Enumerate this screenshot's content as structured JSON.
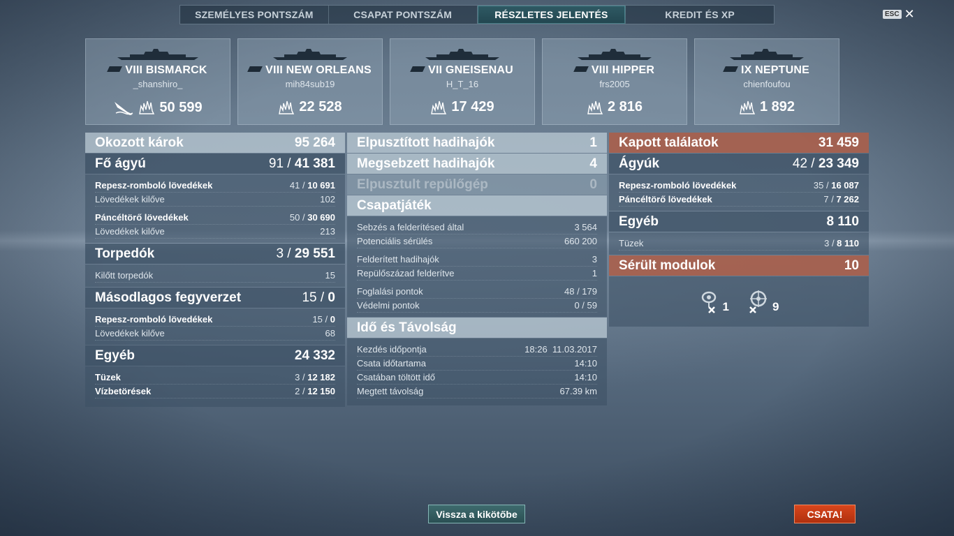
{
  "tabs": [
    "SZEMÉLYES PONTSZÁM",
    "CSAPAT PONTSZÁM",
    "RÉSZLETES JELENTÉS",
    "KREDIT ÉS XP"
  ],
  "active_tab": 2,
  "esc_label": "ESC",
  "cards": [
    {
      "ship": "VIII BISMARCK",
      "player": "_shanshiro_",
      "damage": "50 599",
      "icons": [
        "sunk-ship-icon",
        "damage-splash-icon"
      ]
    },
    {
      "ship": "VIII NEW ORLEANS",
      "player": "mih84sub19",
      "damage": "22 528",
      "icons": [
        "damage-splash-icon"
      ]
    },
    {
      "ship": "VII GNEISENAU",
      "player": "H_T_16",
      "damage": "17 429",
      "icons": [
        "damage-splash-icon"
      ]
    },
    {
      "ship": "VIII HIPPER",
      "player": "frs2005",
      "damage": "2 816",
      "icons": [
        "damage-splash-icon"
      ]
    },
    {
      "ship": "IX NEPTUNE",
      "player": "chienfoufou",
      "damage": "1 892",
      "icons": [
        "damage-splash-icon"
      ]
    }
  ],
  "col1": {
    "damage": {
      "label": "Okozott károk",
      "value": "95 264"
    },
    "main": {
      "label": "Fő ágyú",
      "hits": "91",
      "value": "41 381"
    },
    "he": {
      "label": "Repesz-romboló lövedékek",
      "hits": "41",
      "value": "10 691"
    },
    "he_fired": {
      "label": "Lövedékek kilőve",
      "value": "102"
    },
    "ap": {
      "label": "Páncéltörő lövedékek",
      "hits": "50",
      "value": "30 690"
    },
    "ap_fired": {
      "label": "Lövedékek kilőve",
      "value": "213"
    },
    "torp": {
      "label": "Torpedók",
      "hits": "3",
      "value": "29 551"
    },
    "torp_fired": {
      "label": "Kilőtt torpedók",
      "value": "15"
    },
    "sec": {
      "label": "Másodlagos fegyverzet",
      "hits": "15",
      "value": "0"
    },
    "sec_he": {
      "label": "Repesz-romboló lövedékek",
      "hits": "15",
      "value": "0"
    },
    "sec_fired": {
      "label": "Lövedékek kilőve",
      "value": "68"
    },
    "other": {
      "label": "Egyéb",
      "value": "24 332"
    },
    "fires": {
      "label": "Tüzek",
      "hits": "3",
      "value": "12 182"
    },
    "flood": {
      "label": "Vízbetörések",
      "hits": "2",
      "value": "12 150"
    }
  },
  "col2": {
    "destroyed": {
      "label": "Elpusztított hadihajók",
      "value": "1"
    },
    "damaged": {
      "label": "Megsebzett hadihajók",
      "value": "4"
    },
    "planes": {
      "label": "Elpusztult repülőgép",
      "value": "0"
    },
    "team": {
      "label": "Csapatjáték"
    },
    "spot_dmg": {
      "label": "Sebzés a felderítésed által",
      "value": "3 564"
    },
    "potential": {
      "label": "Potenciális sérülés",
      "value": "660 200"
    },
    "spotted": {
      "label": "Felderített hadihajók",
      "value": "3"
    },
    "squad": {
      "label": "Repülőszázad felderítve",
      "value": "1"
    },
    "capture": {
      "label": "Foglalási pontok",
      "value": "48 / 179"
    },
    "defense": {
      "label": "Védelmi pontok",
      "value": "0 / 59"
    },
    "time": {
      "label": "Idő és Távolság"
    },
    "start": {
      "label": "Kezdés időpontja",
      "value": "18:26  11.03.2017"
    },
    "duration": {
      "label": "Csata időtartama",
      "value": "14:10"
    },
    "in_battle": {
      "label": "Csatában töltött idő",
      "value": "14:10"
    },
    "distance": {
      "label": "Megtett távolság",
      "value": "67.39 km"
    }
  },
  "col3": {
    "received": {
      "label": "Kapott találatok",
      "value": "31 459"
    },
    "guns": {
      "label": "Ágyúk",
      "hits": "42",
      "value": "23 349"
    },
    "he": {
      "label": "Repesz-romboló lövedékek",
      "hits": "35",
      "value": "16 087"
    },
    "ap": {
      "label": "Páncéltörő lövedékek",
      "hits": "7",
      "value": "7 262"
    },
    "other": {
      "label": "Egyéb",
      "value": "8 110"
    },
    "fires": {
      "label": "Tüzek",
      "hits": "3",
      "value": "8 110"
    },
    "modules": {
      "label": "Sérült modulok",
      "value": "10"
    },
    "mod_engine": "1",
    "mod_steering": "9"
  },
  "buttons": {
    "port": "Vissza a kikötőbe",
    "battle": "CSATA!"
  }
}
